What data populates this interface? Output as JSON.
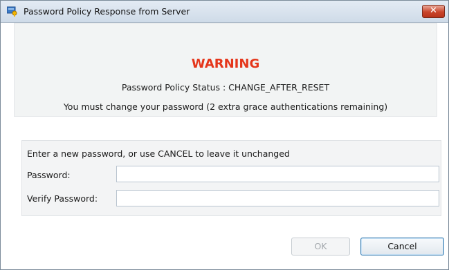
{
  "window": {
    "title": "Password Policy Response from Server",
    "close_glyph": "✕"
  },
  "warning": {
    "heading": "WARNING",
    "status": "Password Policy Status : CHANGE_AFTER_RESET",
    "message": "You must change your password (2 extra grace authentications remaining)"
  },
  "form": {
    "instruction": "Enter a new password, or use CANCEL to leave it unchanged",
    "password_label": "Password:",
    "password_value": "",
    "verify_label": "Verify Password:",
    "verify_value": ""
  },
  "buttons": {
    "ok_label": "OK",
    "ok_enabled": false,
    "cancel_label": "Cancel"
  },
  "colors": {
    "warning": "#e5361b",
    "close_button": "#c9442a",
    "focus_border": "#3c7fb1"
  },
  "icons": {
    "app": "key-icon",
    "close": "close-icon"
  }
}
